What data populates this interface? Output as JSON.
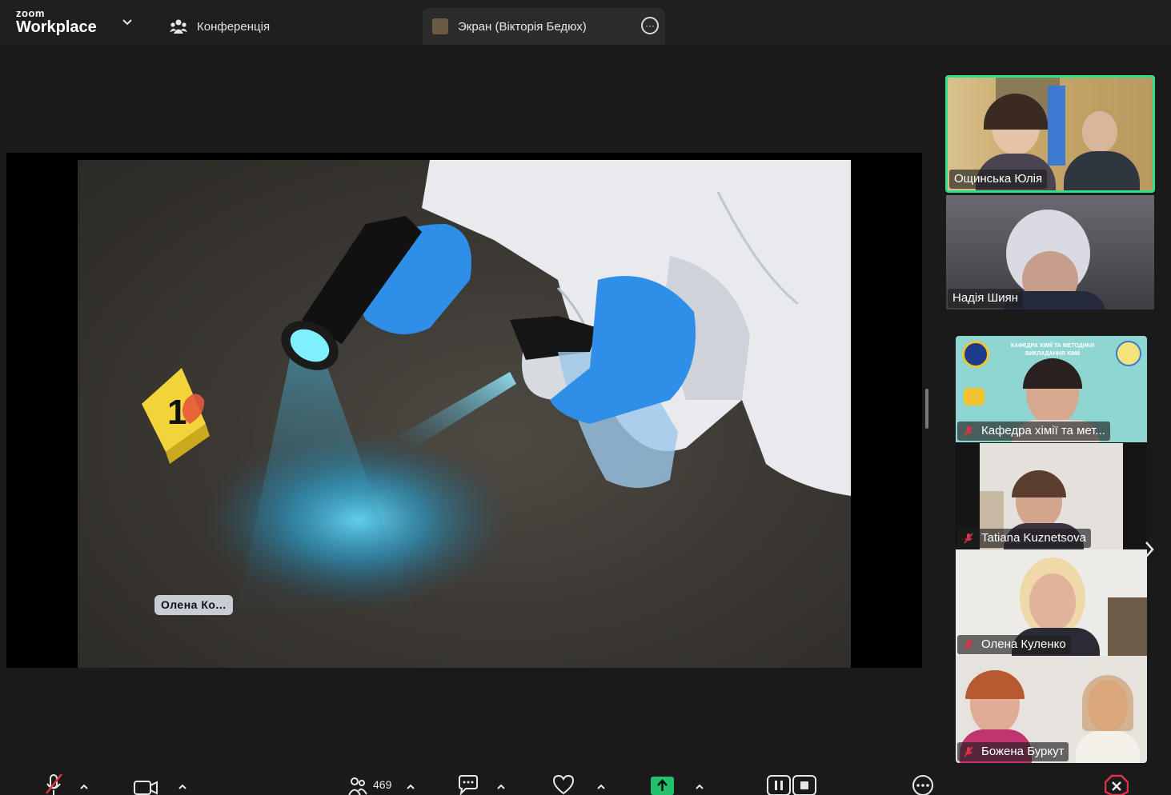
{
  "app": {
    "brand_small": "zoom",
    "brand_big": "Workplace"
  },
  "tabs": {
    "conference_label": "Конференція",
    "screen_label": "Экран (Вікторія Бедюх)",
    "more_label": "···"
  },
  "shared_screen": {
    "evidence_marker": "1",
    "annotation_label": "Олена  Ко..."
  },
  "participants": [
    {
      "name": "Ощинська Юлія",
      "muted": false,
      "active_speaker": true
    },
    {
      "name": "Надія Шиян",
      "muted": false,
      "active_speaker": false
    },
    {
      "name": "Кафедра хімії та мет...",
      "muted": true,
      "active_speaker": false,
      "banner_line1": "КАФЕДРА ХІМІЇ ТА МЕТОДИКИ",
      "banner_line2": "ВИКЛАДАННЯ ХІМІЇ"
    },
    {
      "name": "Tatiana Kuznetsova",
      "muted": true,
      "active_speaker": false
    },
    {
      "name": "Олена Куленко",
      "muted": true,
      "active_speaker": false
    },
    {
      "name": "Божена Буркут",
      "muted": true,
      "active_speaker": false
    }
  ],
  "toolbar": {
    "participants_count": "469"
  },
  "colors": {
    "active_border": "#2fe08a",
    "share_green": "#23c16b",
    "end_red": "#e0314a",
    "glove_blue": "#2f8fe8"
  },
  "icons": [
    "mic-muted-icon",
    "video-icon",
    "participants-icon",
    "chat-icon",
    "react-heart-icon",
    "share-icon",
    "pause-share-icon",
    "stop-share-icon",
    "more-icon",
    "end-icon"
  ]
}
